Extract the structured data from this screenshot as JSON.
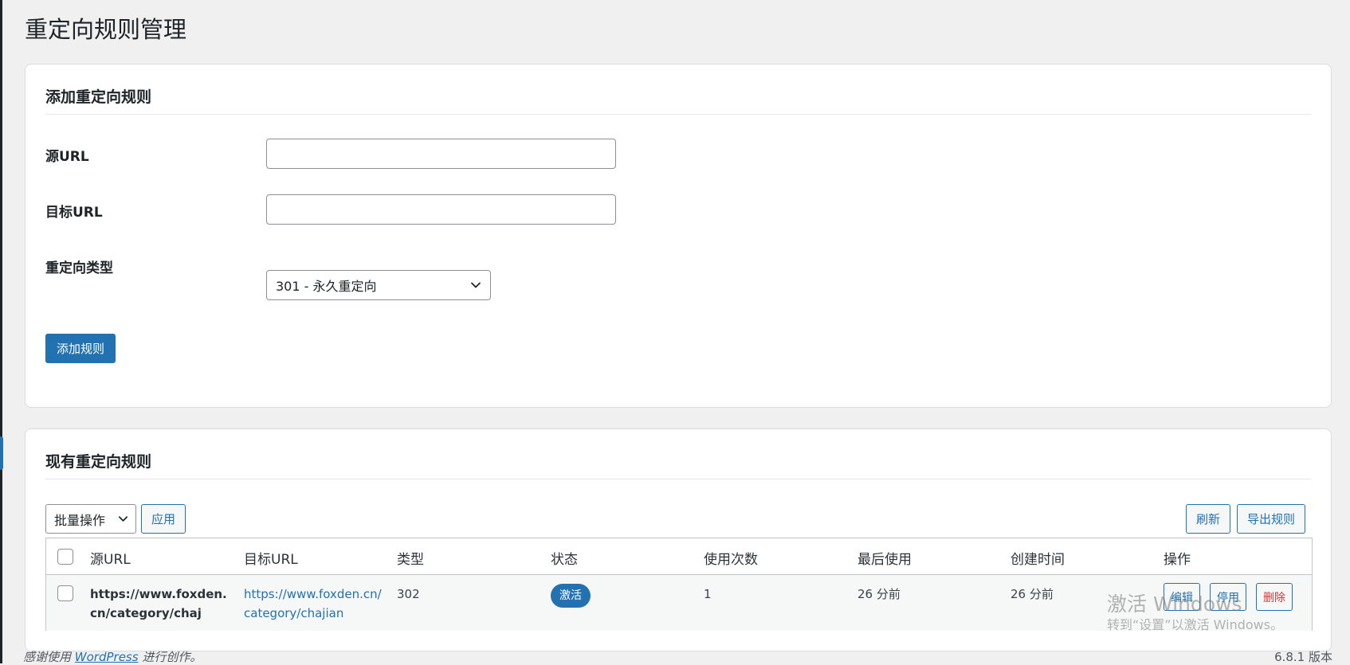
{
  "page": {
    "title": "重定向规则管理"
  },
  "add_form": {
    "heading": "添加重定向规则",
    "source_label": "源URL",
    "source_value": "",
    "target_label": "目标URL",
    "target_value": "",
    "type_label": "重定向类型",
    "type_selected": "301 - 永久重定向",
    "submit_label": "添加规则"
  },
  "rules_list": {
    "heading": "现有重定向规则",
    "bulk_select": "批量操作",
    "apply_label": "应用",
    "refresh_label": "刷新",
    "export_label": "导出规则",
    "columns": [
      "源URL",
      "目标URL",
      "类型",
      "状态",
      "使用次数",
      "最后使用",
      "创建时间",
      "操作"
    ],
    "rows": [
      {
        "source": "https://www.foxden.cn/category/chaj",
        "target": "https://www.foxden.cn/category/chajian",
        "type": "302",
        "status": "激活",
        "uses": "1",
        "last_used": "26 分前",
        "created": "26 分前",
        "actions": {
          "edit": "编辑",
          "disable": "停用",
          "delete": "删除"
        }
      }
    ]
  },
  "watermark": {
    "line1": "激活 Windows",
    "line2": "转到“设置”以激活 Windows。"
  },
  "footer": {
    "thanks_prefix": "感谢使用",
    "wordpress_link": "WordPress",
    "thanks_suffix": "进行创作。",
    "version": "6.8.1 版本"
  },
  "colors": {
    "accent": "#2271b1",
    "danger": "#d63638",
    "background": "#f0f0f1",
    "card": "#ffffff"
  },
  "icons": {
    "select_arrow": "chevron-down-icon"
  }
}
